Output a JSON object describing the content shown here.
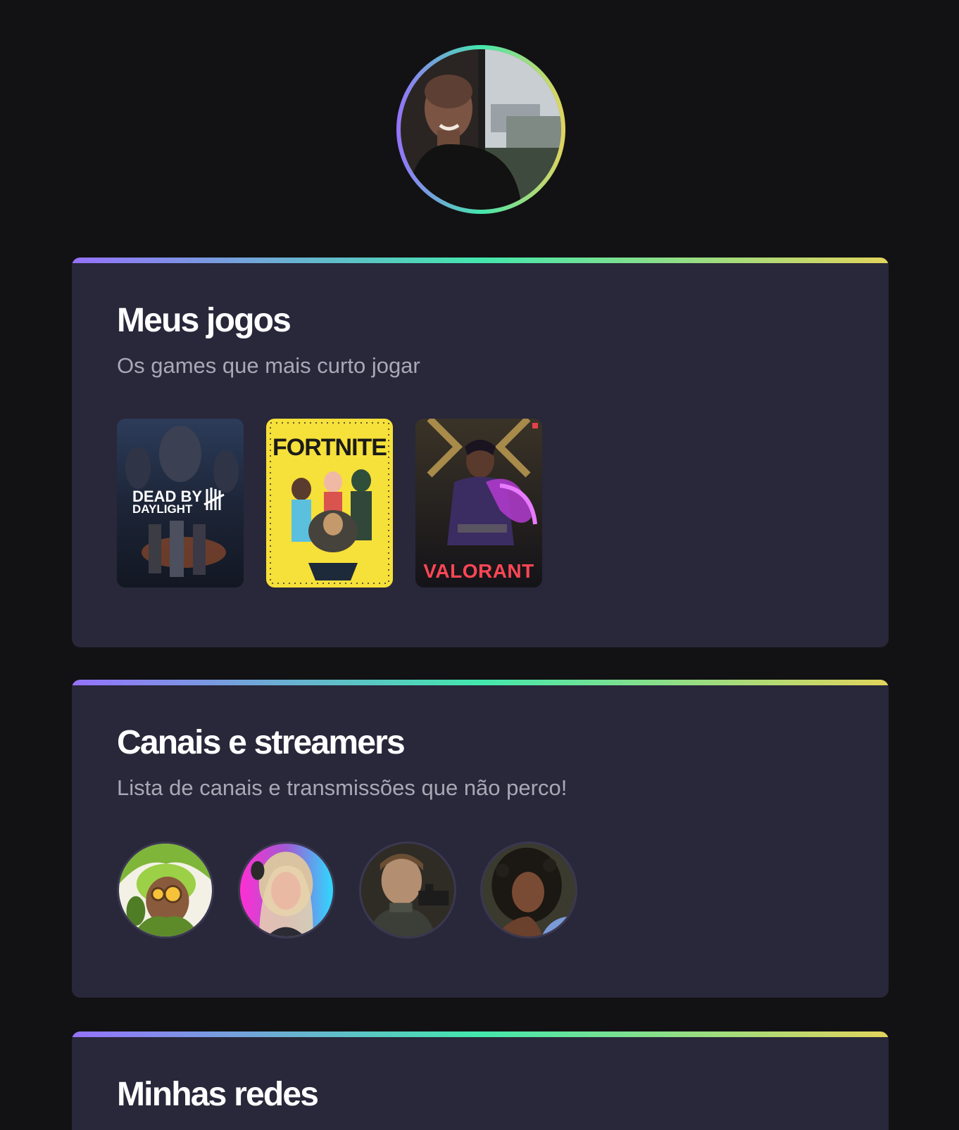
{
  "profile": {
    "avatar_alt": "Foto de perfil"
  },
  "sections": {
    "games": {
      "title": "Meus jogos",
      "subtitle": "Os games que mais curto jogar",
      "items": [
        {
          "name": "Dead by Daylight",
          "logo_line1": "DEAD BY",
          "logo_line2": "DAYLIGHT"
        },
        {
          "name": "Fortnite",
          "logo": "FORTNITE"
        },
        {
          "name": "Valorant",
          "logo": "VALORANT"
        }
      ]
    },
    "streamers": {
      "title": "Canais e streamers",
      "subtitle": "Lista de canais e transmissões que não perco!"
    },
    "networks": {
      "title": "Minhas redes"
    }
  },
  "colors": {
    "background": "#121214",
    "card": "#29273a",
    "gradient": [
      "#9572FC",
      "#43E7AD",
      "#E2D45C"
    ],
    "subtitle": "#a9a8b6"
  }
}
